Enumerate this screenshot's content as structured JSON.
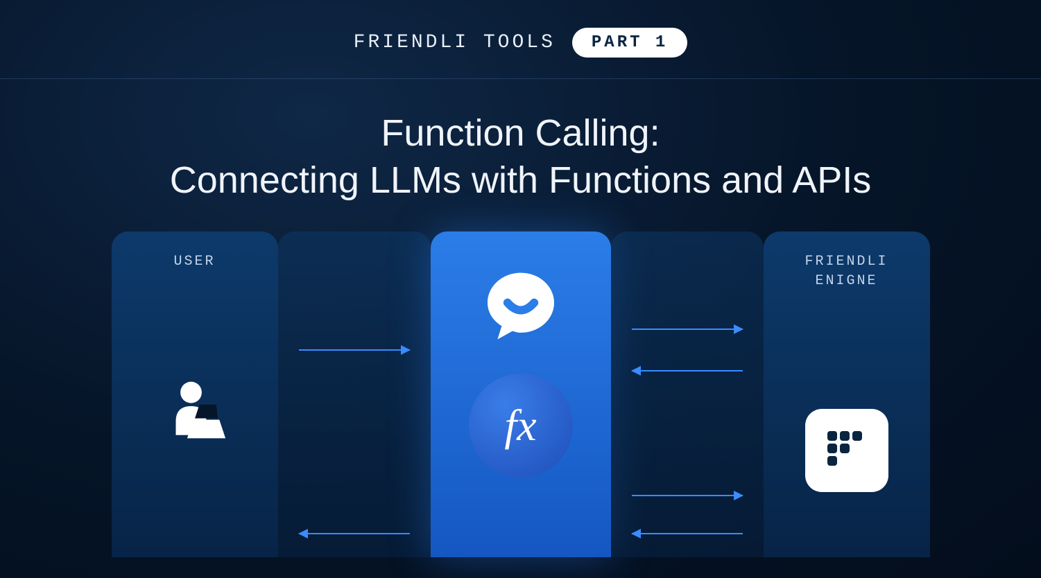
{
  "header": {
    "label": "FRIENDLI TOOLS",
    "badge": "PART 1"
  },
  "title_line1": "Function Calling:",
  "title_line2": "Connecting LLMs with Functions and APIs",
  "columns": {
    "user_label": "USER",
    "engine_label_line1": "FRIENDLI",
    "engine_label_line2": "ENIGNE"
  },
  "center": {
    "fx_symbol": "fx"
  },
  "icons": {
    "user": "user-with-laptop-icon",
    "chat": "chat-bubble-smile-icon",
    "fx": "function-fx-icon",
    "engine": "friendli-logo-icon"
  },
  "colors": {
    "accent": "#3a8cff",
    "bg_dark": "#061529",
    "center_col": "#2b7de8"
  }
}
